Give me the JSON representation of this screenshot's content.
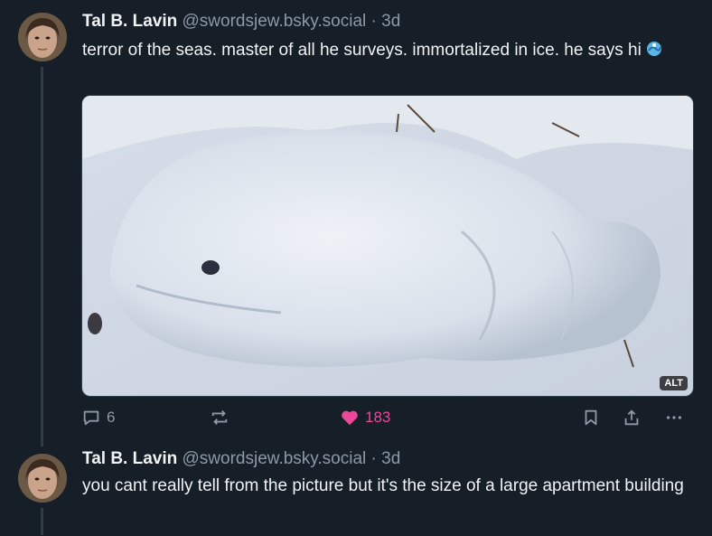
{
  "posts": [
    {
      "author_name": "Tal B. Lavin",
      "handle": "@swordsjew.bsky.social",
      "separator": "·",
      "time": "3d",
      "text": "terror of the seas. master of all he surveys. immortalized in ice. he says hi",
      "emoji_icon": "wave-emoji-icon",
      "image_alt_badge": "ALT",
      "actions": {
        "reply_count": "6",
        "repost_count": "",
        "like_count": "183"
      }
    },
    {
      "author_name": "Tal B. Lavin",
      "handle": "@swordsjew.bsky.social",
      "separator": "·",
      "time": "3d",
      "text": "you cant really tell from the picture but it's the size of a large apartment building"
    }
  ],
  "colors": {
    "background": "#161e27",
    "text": "#f1f3f5",
    "muted": "#8d99a8",
    "like": "#ec4899",
    "thread_line": "#2e3c4c"
  }
}
